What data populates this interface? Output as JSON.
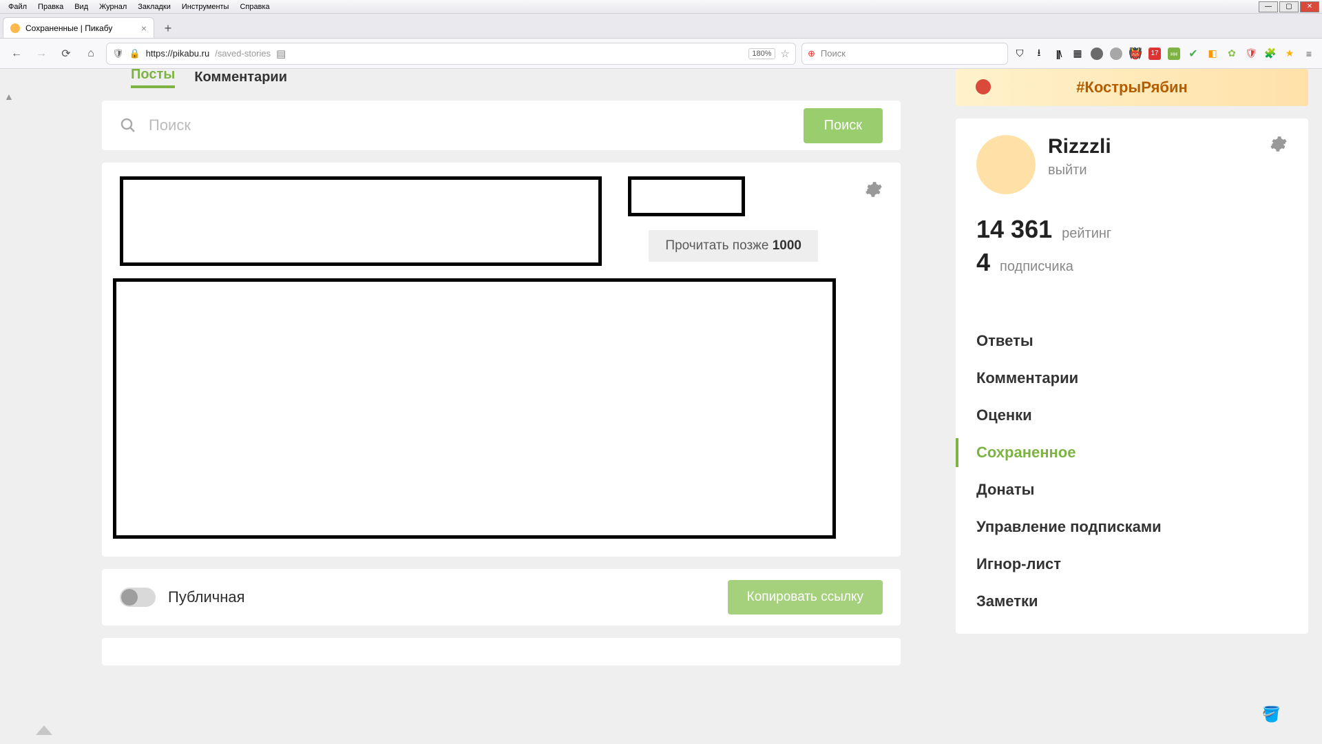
{
  "menubar": {
    "items": [
      "Файл",
      "Правка",
      "Вид",
      "Журнал",
      "Закладки",
      "Инструменты",
      "Справка"
    ]
  },
  "tab": {
    "title": "Сохраненные | Пикабу"
  },
  "toolbar": {
    "url_main": "https://pikabu.ru",
    "url_tail": "/saved-stories",
    "zoom": "180%",
    "search_placeholder": "Поиск"
  },
  "page_tabs": {
    "active": "Посты",
    "inactive": "Комментарии"
  },
  "search": {
    "placeholder": "Поиск",
    "button": "Поиск"
  },
  "read_later": {
    "label": "Прочитать позже ",
    "count": "1000"
  },
  "public": {
    "label": "Публичная",
    "copy": "Копировать ссылку"
  },
  "banner": {
    "text": "#КострыРябин"
  },
  "profile": {
    "username": "Rizzzli",
    "logout": "выйти",
    "rating_num": "14 361",
    "rating_label": "рейтинг",
    "subs_num": "4",
    "subs_label": "подписчика"
  },
  "side_menu": {
    "items": [
      "Ответы",
      "Комментарии",
      "Оценки",
      "Сохраненное",
      "Донаты",
      "Управление подписками",
      "Игнор-лист",
      "Заметки"
    ],
    "active_index": 3
  }
}
